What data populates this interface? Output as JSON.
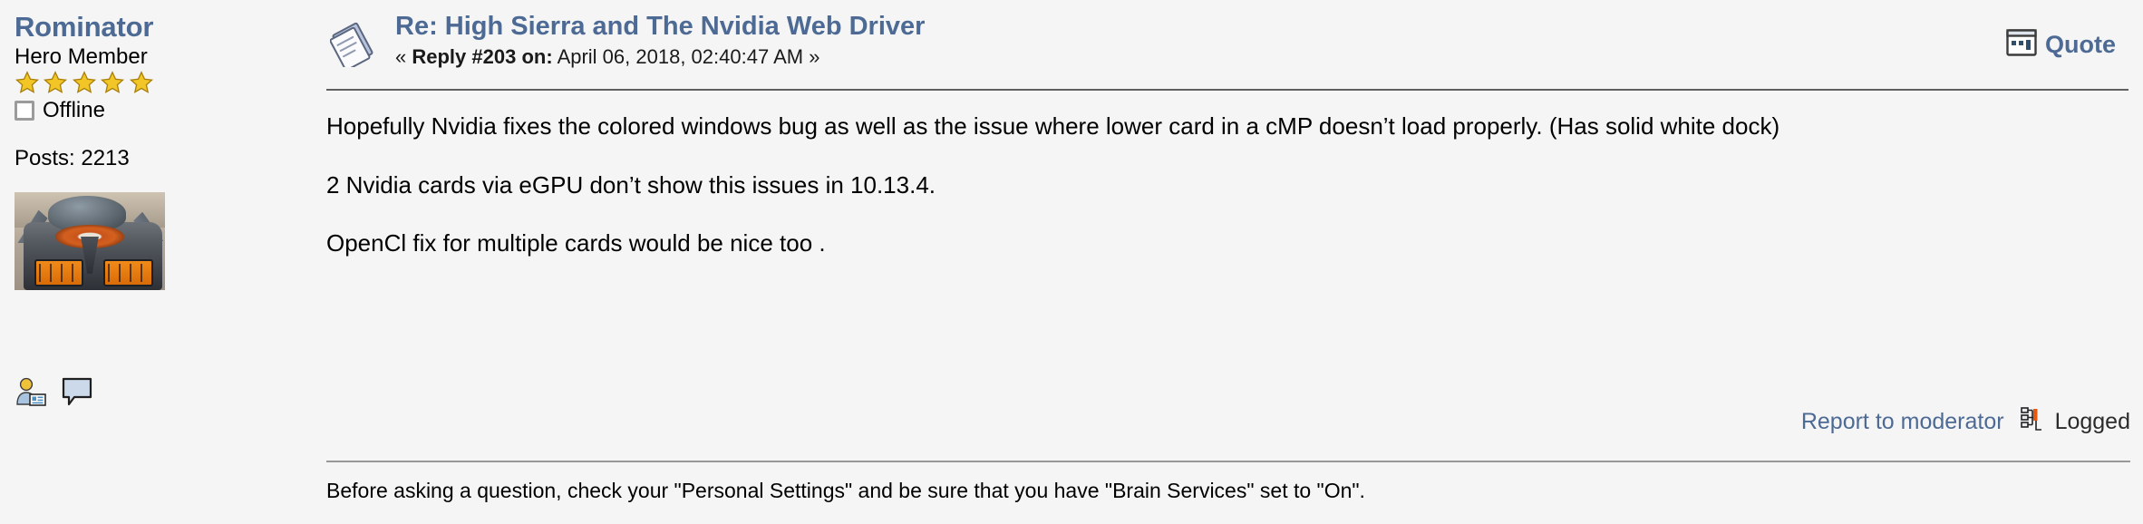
{
  "poster": {
    "name": "Rominator",
    "rank": "Hero Member",
    "stars_count": 5,
    "star_color": "#e8b419",
    "status": "Offline",
    "posts_label": "Posts: 2213",
    "avatar_alt": "user avatar",
    "icons": [
      {
        "name": "view-profile-icon",
        "title": "View Profile"
      },
      {
        "name": "personal-message-icon",
        "title": "Personal Message"
      }
    ]
  },
  "post": {
    "topic_icon": "xx-message-icon",
    "subject": "Re: High Sierra and The Nvidia Web Driver",
    "meta_prefix": "«",
    "meta_reply": "Reply #203 on:",
    "meta_date": "April 06, 2018, 02:40:47 AM",
    "meta_suffix": "»",
    "quote_label": "Quote",
    "quote_icon": "quote-icon",
    "paragraphs": [
      "Hopefully Nvidia fixes the colored windows bug as well as the issue where lower card in a cMP doesn’t load properly. (Has solid white dock)",
      "2 Nvidia cards via eGPU don’t show this issues in 10.13.4.",
      "OpenCl fix for multiple cards would be nice too ."
    ],
    "report_label": "Report to moderator",
    "logged_label": "Logged",
    "logged_icon": "ip-logged-icon",
    "signature": "Before asking a question, check your \"Personal Settings\" and be sure that you have \"Brain Services\" set to \"On\"."
  },
  "colors": {
    "page_bg": "#f5f5f5",
    "link_blue": "#4d6a95",
    "rule_dark": "#606060",
    "rule_light": "#999999",
    "text": "#000000"
  }
}
